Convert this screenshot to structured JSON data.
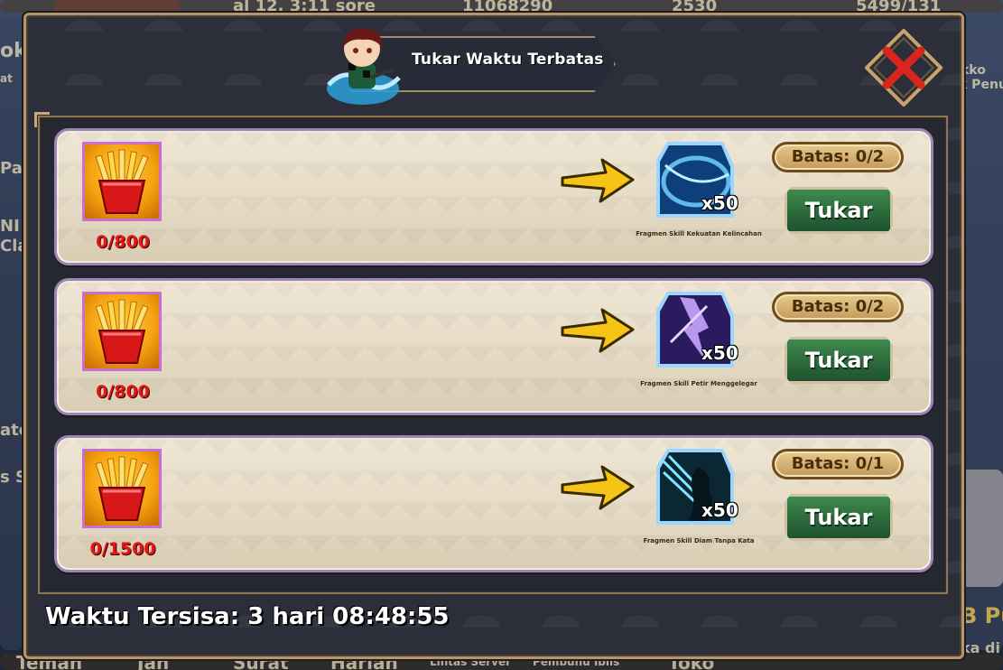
{
  "header": {
    "title": "Tukar Waktu Terbatas"
  },
  "background_text": {
    "top_left": "al 12, 3:11 sore",
    "top_mid": "11068290",
    "top_right1": "2530",
    "top_right2": "5499/131",
    "side_left1": "ok",
    "side_left2": "at",
    "side_left3": "Pa",
    "side_left4": "NI",
    "side_left5": "Cla",
    "side_left6": "ate",
    "side_left7": "s Se",
    "side_right1": "kko",
    "side_right2": "k Penu",
    "side_right3": "B Pu",
    "side_right4": "ka di I",
    "bottom1": "Teman",
    "bottom2": "Jan",
    "bottom3": "Surat",
    "bottom4": "Harian",
    "bottom5": "Lintas Server",
    "bottom6": "Pembunu Iblis",
    "bottom7": "Toko"
  },
  "rows": [
    {
      "cost": "0/800",
      "reward_qty": "x50",
      "reward_name": "Fragmen Skill Kekuatan Kelincahan",
      "limit": "Batas: 0/2",
      "button": "Tukar"
    },
    {
      "cost": "0/800",
      "reward_qty": "x50",
      "reward_name": "Fragmen Skill Petir Menggelegar",
      "limit": "Batas: 0/2",
      "button": "Tukar"
    },
    {
      "cost": "0/1500",
      "reward_qty": "x50",
      "reward_name": "Fragmen Skill Diam Tanpa Kata",
      "limit": "Batas: 0/1",
      "button": "Tukar"
    }
  ],
  "footer": {
    "time_remaining": "Waktu Tersisa: 3 hari 08:48:55"
  },
  "colors": {
    "cost_text": "#e41616",
    "button_green": "#2b6a3a",
    "panel_border": "#b8946a",
    "row_border": "#9e86b4"
  },
  "icons": {
    "cost": "fries-icon",
    "arrow": "arrow-right-icon",
    "close": "close-icon"
  }
}
